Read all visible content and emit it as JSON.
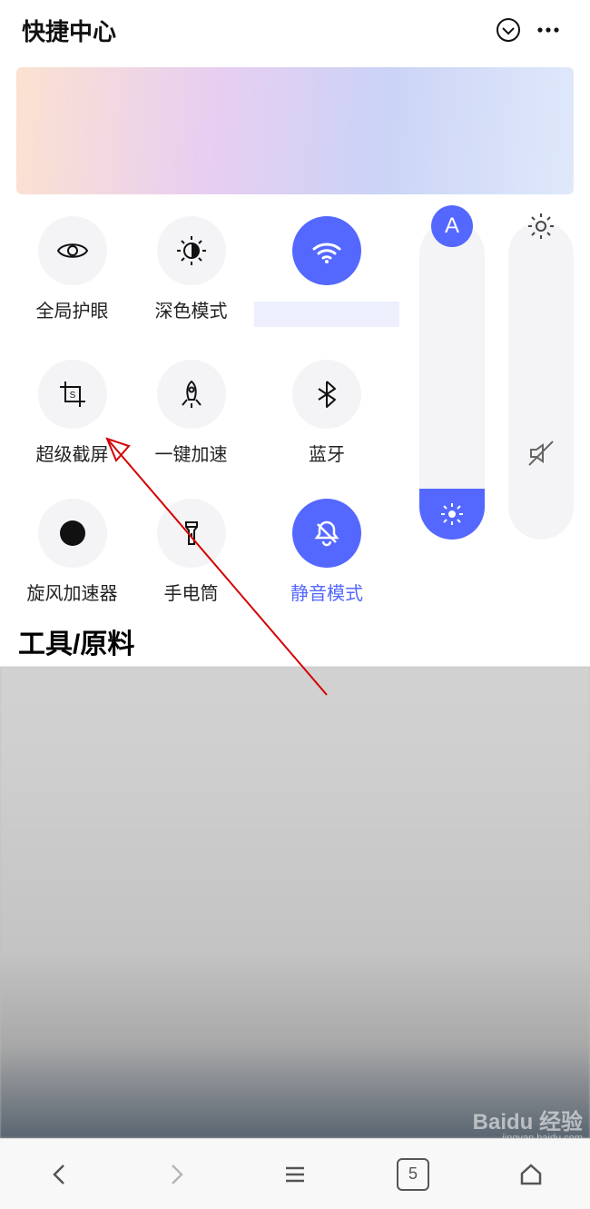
{
  "header": {
    "title": "快捷中心"
  },
  "tiles": {
    "eye": {
      "label": "全局护眼"
    },
    "dark": {
      "label": "深色模式"
    },
    "wifi": {
      "label": ""
    },
    "sshot": {
      "label": "超级截屏"
    },
    "boost": {
      "label": "一键加速"
    },
    "bt": {
      "label": "蓝牙"
    },
    "spin": {
      "label": "旋风加速器"
    },
    "torch": {
      "label": "手电筒"
    },
    "silent": {
      "label": "静音模式"
    }
  },
  "sliders": {
    "auto_brightness_badge": "A"
  },
  "section": {
    "title": "工具/原料"
  },
  "bottombar": {
    "tab_count": "5"
  },
  "watermark": {
    "brand": "Baidu 经验",
    "url": "jingyan.baidu.com"
  },
  "colors": {
    "accent": "#5468ff"
  }
}
